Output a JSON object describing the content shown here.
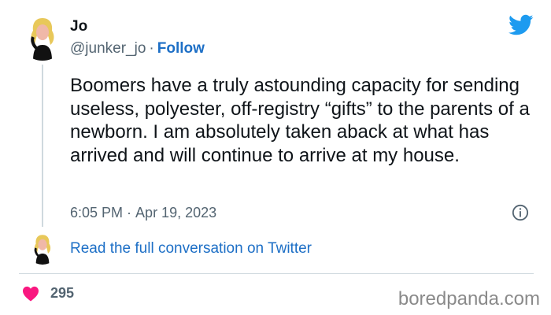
{
  "author": {
    "name": "Jo",
    "handle": "@junker_jo",
    "separator": "·",
    "follow_label": "Follow"
  },
  "tweet": {
    "text": "Boomers have a truly astounding capacity for sending useless, polyester, off-registry “gifts” to the parents of a newborn. I am absolutely taken aback at what has arrived and will continue to arrive at my house.",
    "time": "6:05 PM",
    "separator": "·",
    "date": "Apr 19, 2023"
  },
  "conversation": {
    "link_label": "Read the full conversation on Twitter"
  },
  "engagement": {
    "likes": "295"
  },
  "watermark": {
    "text": "boredpanda.com"
  },
  "icons": {
    "brand": "twitter-bird-icon",
    "info": "info-icon",
    "like": "heart-icon"
  },
  "colors": {
    "link": "#1d6fc6",
    "twitter_blue": "#1d9bf0",
    "heart": "#f91880",
    "muted_text": "#536471",
    "divider": "#cfd9de"
  }
}
